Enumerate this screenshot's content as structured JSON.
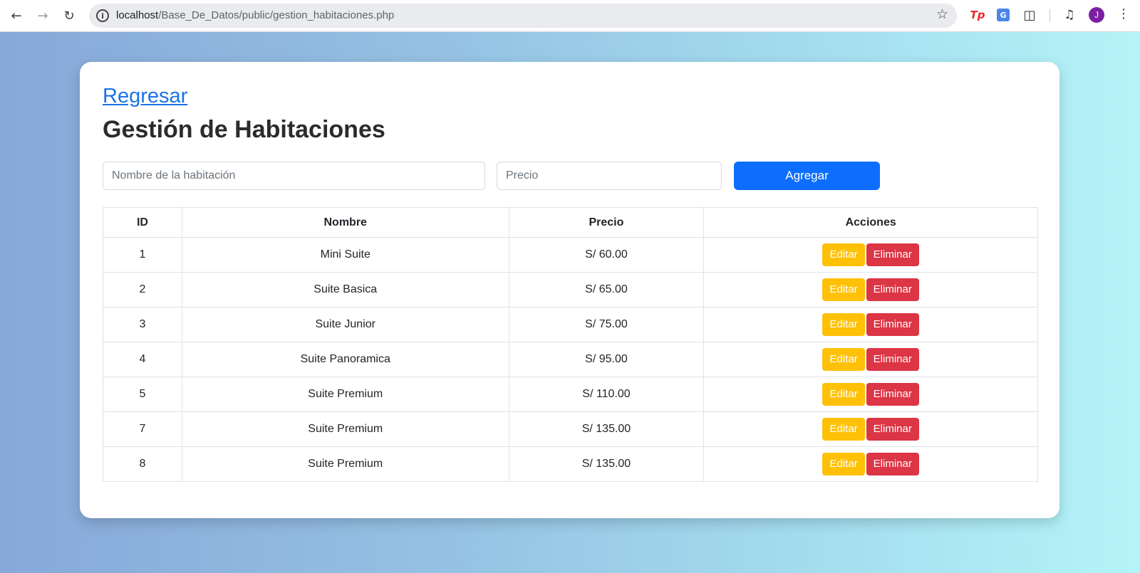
{
  "browser": {
    "url_host": "localhost",
    "url_path": "/Base_De_Datos/public/gestion_habitaciones.php",
    "avatar_letter": "J",
    "tp_extension_label": "Tp",
    "translate_extension_label": "G"
  },
  "page": {
    "back_link": "Regresar",
    "title": "Gestión de Habitaciones"
  },
  "form": {
    "name_placeholder": "Nombre de la habitación",
    "price_placeholder": "Precio",
    "add_button": "Agregar"
  },
  "table": {
    "headers": [
      "ID",
      "Nombre",
      "Precio",
      "Acciones"
    ],
    "rows": [
      {
        "id": "1",
        "name": "Mini Suite",
        "price": "S/ 60.00"
      },
      {
        "id": "2",
        "name": "Suite Basica",
        "price": "S/ 65.00"
      },
      {
        "id": "3",
        "name": "Suite Junior",
        "price": "S/ 75.00"
      },
      {
        "id": "4",
        "name": "Suite Panoramica",
        "price": "S/ 95.00"
      },
      {
        "id": "5",
        "name": "Suite Premium",
        "price": "S/ 110.00"
      },
      {
        "id": "7",
        "name": "Suite Premium",
        "price": "S/ 135.00"
      },
      {
        "id": "8",
        "name": "Suite Premium",
        "price": "S/ 135.00"
      }
    ],
    "edit_label": "Editar",
    "delete_label": "Eliminar"
  },
  "colors": {
    "primary": "#0d6efd",
    "warning": "#ffc107",
    "danger": "#dc3545",
    "link": "#1a73e8"
  },
  "icons": [
    "back-arrow-icon",
    "forward-arrow-icon",
    "reload-icon",
    "site-info-icon",
    "star-icon",
    "puzzle-icon",
    "media-control-icon",
    "kebab-menu-icon"
  ]
}
